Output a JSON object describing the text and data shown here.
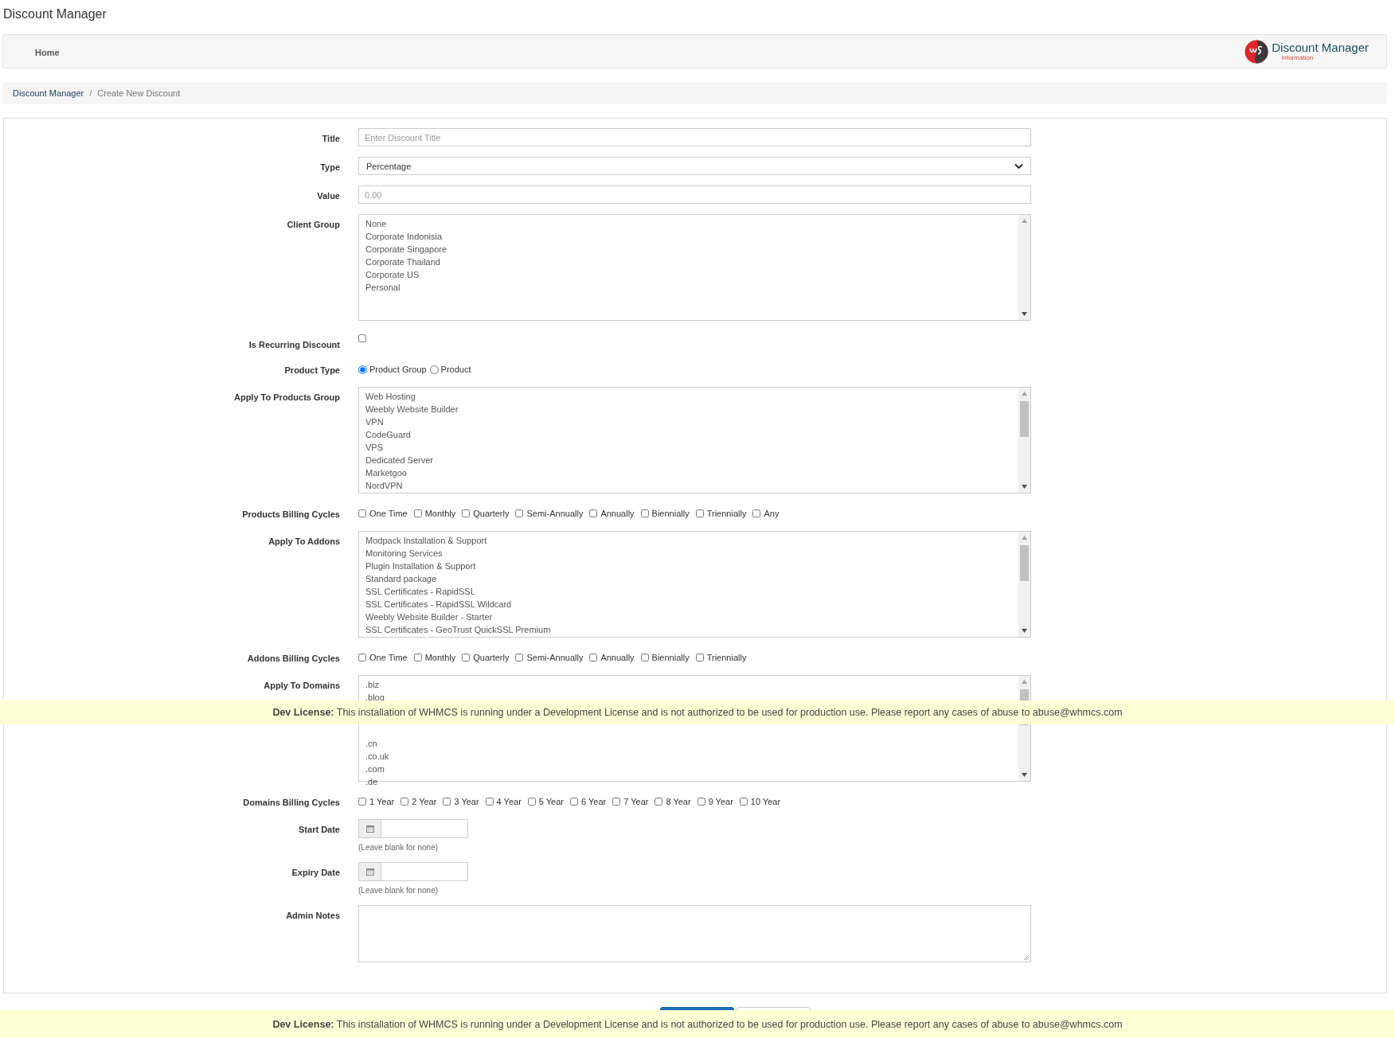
{
  "page_title": "Discount Manager",
  "nav": {
    "items": [
      {
        "label": "Home",
        "selected": false
      }
    ],
    "brand": {
      "name": "Discount Manager",
      "subtitle": "Information"
    }
  },
  "breadcrumb_separator": "/",
  "breadcrumb": [
    {
      "label": "Discount Manager",
      "kind": "link"
    },
    {
      "label": "Create New Discount",
      "kind": "current"
    }
  ],
  "form": {
    "fields": [
      {
        "kind": "text",
        "label": "Title",
        "placeholder": "Enter Discount Title"
      },
      {
        "kind": "select",
        "label": "Type",
        "value": "Percentage"
      },
      {
        "kind": "text",
        "label": "Value",
        "placeholder": "0.00"
      },
      {
        "kind": "listbox",
        "label": "Client Group",
        "scrollable": false,
        "options": [
          "None",
          "Corporate Indonisia",
          "Corporate Singapore",
          "Corporate Thailand",
          "Corporate US",
          "Personal"
        ]
      },
      {
        "kind": "checkbox",
        "label": "Is Recurring Discount",
        "checked": false
      },
      {
        "kind": "radio",
        "label": "Product Type",
        "options": [
          {
            "label": "Product Group",
            "selected": true
          },
          {
            "label": "Product",
            "selected": false
          }
        ]
      },
      {
        "kind": "listbox",
        "label": "Apply To Products Group",
        "scrollable": true,
        "options": [
          "Web Hosting",
          "Weebly Website Builder",
          "VPN",
          "CodeGuard",
          "VPS",
          "Dedicated Server",
          "Marketgoo",
          "NordVPN"
        ]
      },
      {
        "kind": "checkboxes",
        "label": "Products Billing Cycles",
        "options": [
          {
            "label": "One Time",
            "checked": false
          },
          {
            "label": "Monthly",
            "checked": false
          },
          {
            "label": "Quarterly",
            "checked": false
          },
          {
            "label": "Semi-Annually",
            "checked": false
          },
          {
            "label": "Annually",
            "checked": false
          },
          {
            "label": "Biennially",
            "checked": false
          },
          {
            "label": "Triennially",
            "checked": false
          },
          {
            "label": "Any",
            "checked": false
          }
        ]
      },
      {
        "kind": "listbox",
        "label": "Apply To Addons",
        "scrollable": true,
        "options": [
          "Modpack Installation & Support",
          "Monitoring Services",
          "Plugin Installation & Support",
          "Standard package",
          "SSL Certificates - RapidSSL",
          "SSL Certificates - RapidSSL Wildcard",
          "Weebly Website Builder - Starter",
          "SSL Certificates - GeoTrust QuickSSL Premium"
        ]
      },
      {
        "kind": "checkboxes",
        "label": "Addons Billing Cycles",
        "options": [
          {
            "label": "One Time",
            "checked": false
          },
          {
            "label": "Monthly",
            "checked": false
          },
          {
            "label": "Quarterly",
            "checked": false
          },
          {
            "label": "Semi-Annually",
            "checked": false
          },
          {
            "label": "Annually",
            "checked": false
          },
          {
            "label": "Biennially",
            "checked": false
          },
          {
            "label": "Triennially",
            "checked": false
          }
        ]
      },
      {
        "kind": "listbox",
        "label": "Apply To Domains",
        "scrollable": true,
        "options": [
          ".biz",
          ".blog"
        ],
        "options_below_banner": [
          ".cn",
          ".co.uk",
          ".com",
          ".de"
        ]
      },
      {
        "kind": "checkboxes",
        "label": "Domains Billing Cycles",
        "options": [
          {
            "label": "1 Year",
            "checked": false
          },
          {
            "label": "2 Year",
            "checked": false
          },
          {
            "label": "3 Year",
            "checked": false
          },
          {
            "label": "4 Year",
            "checked": false
          },
          {
            "label": "5 Year",
            "checked": false
          },
          {
            "label": "6 Year",
            "checked": false
          },
          {
            "label": "7 Year",
            "checked": false
          },
          {
            "label": "8 Year",
            "checked": false
          },
          {
            "label": "9 Year",
            "checked": false
          },
          {
            "label": "10 Year",
            "checked": false
          }
        ]
      },
      {
        "kind": "date",
        "label": "Start Date",
        "hint": "(Leave blank for none)"
      },
      {
        "kind": "date",
        "label": "Expiry Date",
        "hint": "(Leave blank for none)"
      },
      {
        "kind": "textarea",
        "label": "Admin Notes"
      }
    ]
  },
  "buttons": [
    {
      "kind": "primary"
    },
    {
      "kind": "secondary"
    }
  ],
  "banners": [
    {
      "text": "**Dev License:** This installation of WHMCS is running under a Development License and is not authorized to be used for production use. Please report any cases of abuse to abuse@whmcs.com"
    },
    {
      "text": "**Dev License:** This installation of WHMCS is running under a Development License and is not authorized to be used for production use. Please report any cases of abuse to abuse@whmcs.com"
    }
  ]
}
